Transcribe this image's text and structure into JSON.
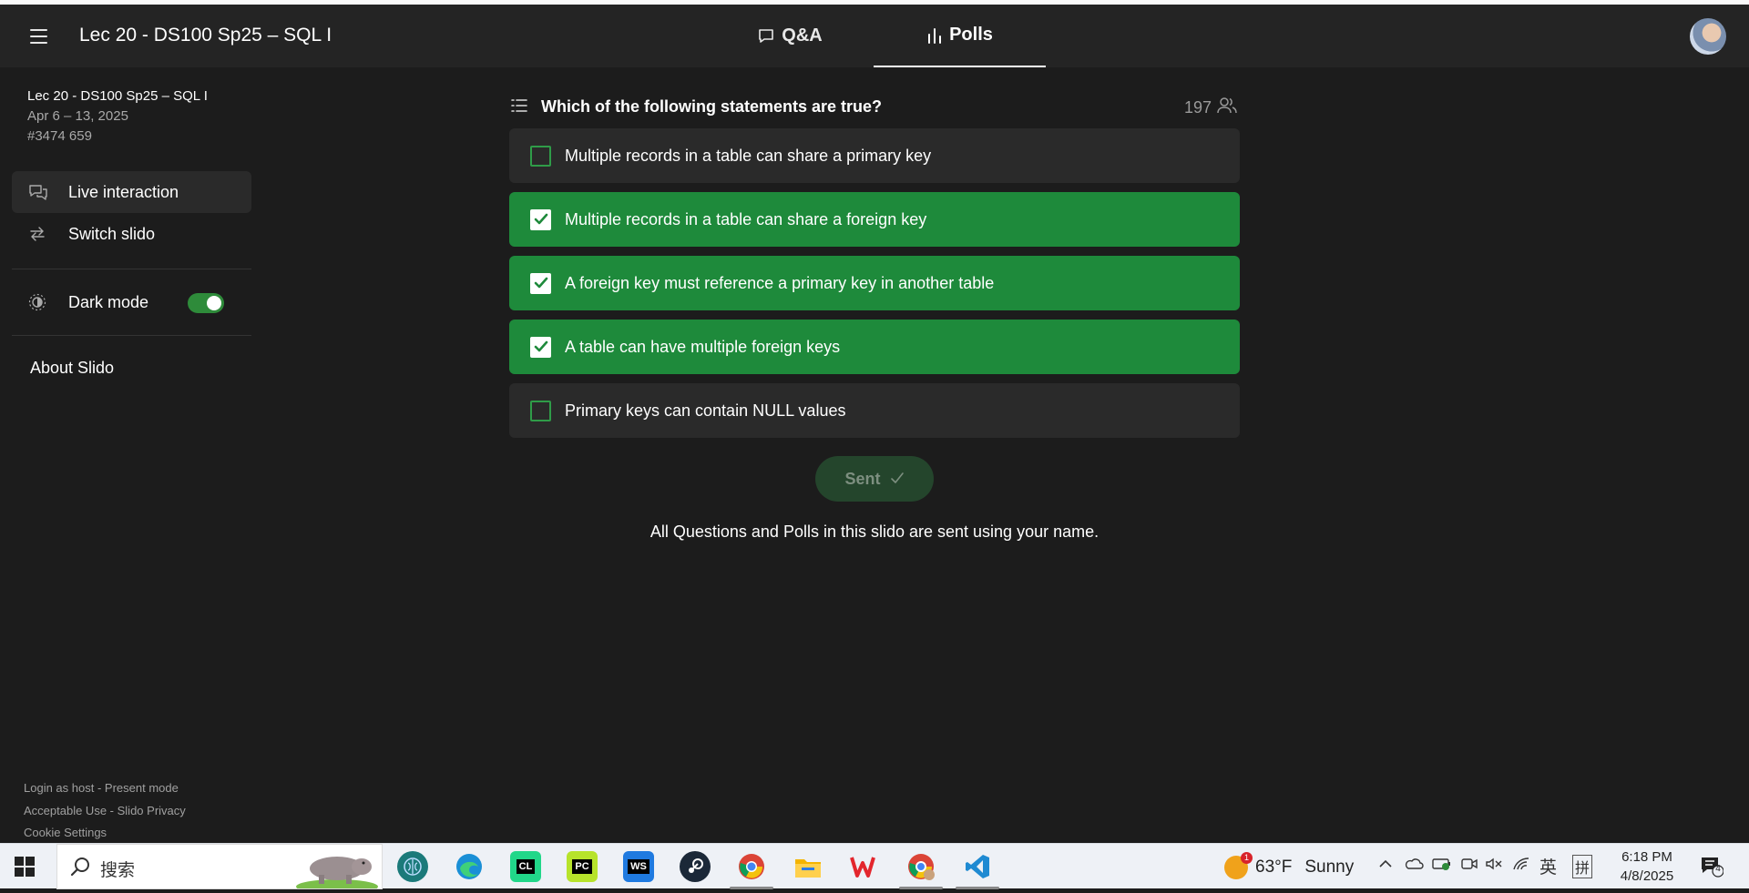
{
  "header": {
    "title": "Lec 20 - DS100 Sp25 – SQL I",
    "tabs": [
      {
        "label": "Q&A",
        "active": false
      },
      {
        "label": "Polls",
        "active": true
      }
    ]
  },
  "sidebar": {
    "event_name": "Lec 20 - DS100 Sp25 – SQL I",
    "event_dates": "Apr 6 – 13, 2025",
    "event_code": "#3474 659",
    "items": [
      {
        "label": "Live interaction",
        "icon": "chat-bubbles-icon",
        "active": true
      },
      {
        "label": "Switch slido",
        "icon": "switch-arrows-icon",
        "active": false
      }
    ],
    "dark_mode": {
      "label": "Dark mode",
      "on": true,
      "icon": "sun-moon-icon"
    },
    "about_label": "About Slido",
    "footer": {
      "login_host": "Login as host",
      "present_mode": "Present mode",
      "acceptable_use": "Acceptable Use",
      "privacy": "Slido Privacy",
      "cookie_settings": "Cookie Settings",
      "separator": " - "
    }
  },
  "poll": {
    "question": "Which of the following statements are true?",
    "votes": "197",
    "options": [
      {
        "label": "Multiple records in a table can share a primary key",
        "checked": false
      },
      {
        "label": "Multiple records in a table can share a foreign key",
        "checked": true
      },
      {
        "label": "A foreign key must reference a primary key in another table",
        "checked": true
      },
      {
        "label": "A table can have multiple foreign keys",
        "checked": true
      },
      {
        "label": "Primary keys can contain NULL values",
        "checked": false
      }
    ],
    "sent_label": "Sent",
    "notice": "All Questions and Polls in this slido are sent using your name."
  },
  "taskbar": {
    "search_text": "搜索",
    "apps": [
      {
        "name": "brain-app-icon",
        "label": ""
      },
      {
        "name": "edge-icon",
        "label": ""
      },
      {
        "name": "clion-icon",
        "label": "CL"
      },
      {
        "name": "pycharm-icon",
        "label": "PC"
      },
      {
        "name": "webstorm-icon",
        "label": "WS"
      },
      {
        "name": "steam-icon",
        "label": ""
      },
      {
        "name": "chrome-icon",
        "label": ""
      },
      {
        "name": "file-explorer-icon",
        "label": ""
      },
      {
        "name": "wps-icon",
        "label": ""
      },
      {
        "name": "chrome-profile-icon",
        "label": ""
      },
      {
        "name": "vscode-icon",
        "label": ""
      }
    ],
    "weather": {
      "temp": "63°F",
      "condition": "Sunny",
      "badge": "1"
    },
    "ime_lang": "英",
    "ime_mode": "拼",
    "time": "6:18 PM",
    "date": "4/8/2025",
    "notification_count": "4"
  },
  "colors": {
    "background": "#1c1c1c",
    "header": "#242424",
    "selected_option": "#1e8a3b",
    "unselected_option": "#2a2a2a",
    "sent_button": "#24452c"
  }
}
